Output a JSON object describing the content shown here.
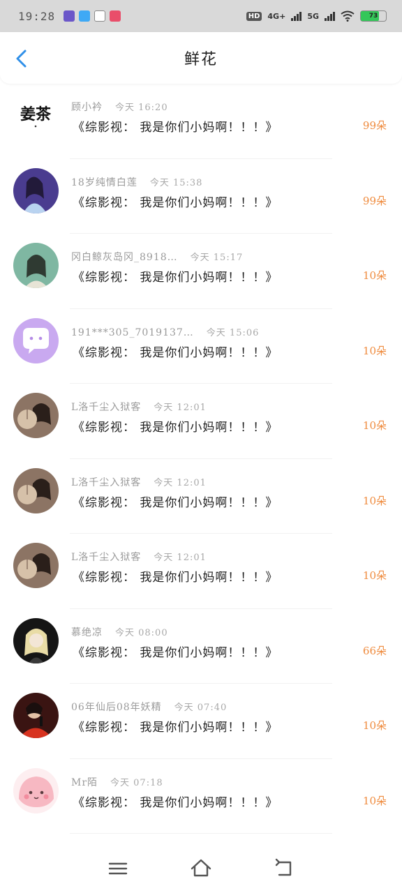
{
  "status_bar": {
    "time": "19:28",
    "app_icons": [
      {
        "name": "kuaikan-icon",
        "color": "#6b57c9"
      },
      {
        "name": "browser-icon",
        "color": "#3fa9f5"
      },
      {
        "name": "notes-icon",
        "color": "#888888"
      },
      {
        "name": "chat-app-icon",
        "color": "#e94e6a"
      }
    ],
    "hd": "HD",
    "network_4g": "4G+",
    "network_5g": "5G",
    "battery": "73",
    "battery_level": 0.73
  },
  "header": {
    "title": "鲜花"
  },
  "records": [
    {
      "name": "顾小衿",
      "time": "今天 16:20",
      "message": "《综影视： 我是你们小妈啊！！！》",
      "flowers": "99朵",
      "avatar": "logo"
    },
    {
      "name": "18岁纯情白莲",
      "time": "今天 15:38",
      "message": "《综影视： 我是你们小妈啊！！！》",
      "flowers": "99朵",
      "avatar": "girl-blue"
    },
    {
      "name": "冈白鲸灰岛冈_8918…",
      "time": "今天 15:17",
      "message": "《综影视： 我是你们小妈啊！！！》",
      "flowers": "10朵",
      "avatar": "girl-green"
    },
    {
      "name": "191***305_7019137…",
      "time": "今天 15:06",
      "message": "《综影视： 我是你们小妈啊！！！》",
      "flowers": "10朵",
      "avatar": "chat-bubble"
    },
    {
      "name": "L洛千尘入狱客",
      "time": "今天 12:01",
      "message": "《综影视： 我是你们小妈啊！！！》",
      "flowers": "10朵",
      "avatar": "girl-fan"
    },
    {
      "name": "L洛千尘入狱客",
      "time": "今天 12:01",
      "message": "《综影视： 我是你们小妈啊！！！》",
      "flowers": "10朵",
      "avatar": "girl-fan"
    },
    {
      "name": "L洛千尘入狱客",
      "time": "今天 12:01",
      "message": "《综影视： 我是你们小妈啊！！！》",
      "flowers": "10朵",
      "avatar": "girl-fan"
    },
    {
      "name": "慕绝凉",
      "time": "今天 08:00",
      "message": "《综影视： 我是你们小妈啊！！！》",
      "flowers": "66朵",
      "avatar": "anime-blonde"
    },
    {
      "name": "06年仙后08年妖精",
      "time": "今天 07:40",
      "message": "《综影视： 我是你们小妈啊！！！》",
      "flowers": "10朵",
      "avatar": "singer-red"
    },
    {
      "name": "Mr陌",
      "time": "今天 07:18",
      "message": "《综影视： 我是你们小妈啊！！！》",
      "flowers": "10朵",
      "avatar": "pink-blob"
    }
  ],
  "colors": {
    "accent": "#2f8fe8",
    "flowers": "#ef8a3c",
    "status_bar_bg": "#d9d9d9"
  }
}
